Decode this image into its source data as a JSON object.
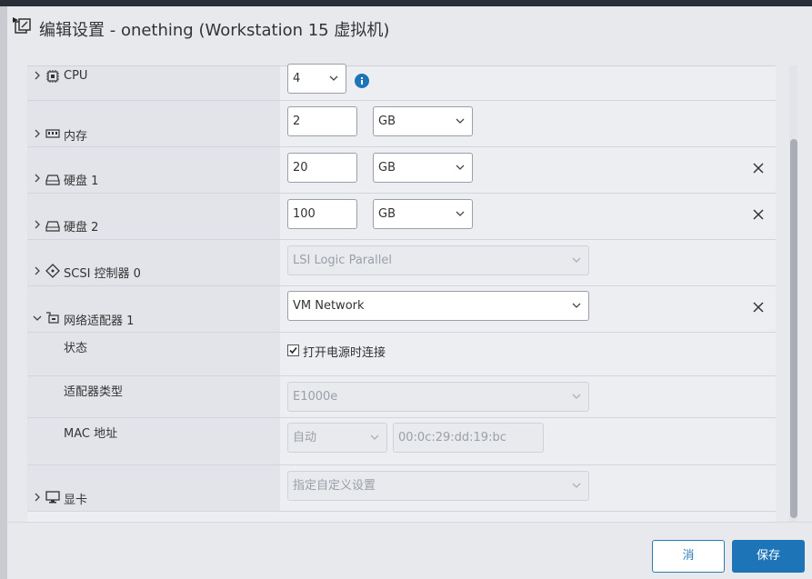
{
  "title": "编辑设置 - onething (Workstation 15 虚拟机)",
  "colors": {
    "accent": "#1d75b8",
    "info": "#1d75b8"
  },
  "rows": {
    "cpu": {
      "label": "CPU",
      "icon": "cpu-icon",
      "value": "4"
    },
    "memory": {
      "label": "内存",
      "icon": "memory-icon",
      "value": "2",
      "unit": "GB"
    },
    "disk1": {
      "label": "硬盘 1",
      "icon": "disk-icon",
      "value": "20",
      "unit": "GB"
    },
    "disk2": {
      "label": "硬盘 2",
      "icon": "disk-icon",
      "value": "100",
      "unit": "GB"
    },
    "scsi": {
      "label": "SCSI 控制器 0",
      "icon": "scsi-icon",
      "value": "LSI Logic Parallel"
    },
    "network": {
      "label": "网络适配器 1",
      "icon": "network-adapter-icon",
      "value": "VM Network",
      "status_label": "状态",
      "connect_label": "打开电源时连接",
      "connect_checked": true,
      "adapter_type_label": "适配器类型",
      "adapter_type_value": "E1000e",
      "mac_label": "MAC 地址",
      "mac_mode": "自动",
      "mac_value": "00:0c:29:dd:19:bc"
    },
    "display": {
      "label": "显卡",
      "icon": "monitor-icon",
      "value": "指定自定义设置"
    }
  },
  "footer": {
    "cancel_label": "消",
    "save_label": "保存"
  }
}
